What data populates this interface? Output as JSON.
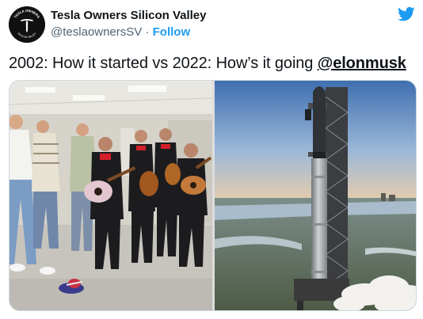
{
  "header": {
    "display_name": "Tesla Owners Silicon Valley",
    "handle": "@teslaownersSV",
    "separator": "·",
    "follow_label": "Follow",
    "avatar_text_top": "TESLA OWNERS",
    "avatar_text_bottom": "SILICON VALLEY",
    "avatar_icon": "tesla-t-logo",
    "brand_icon": "twitter-bird-icon"
  },
  "tweet": {
    "text": "2002: How it started vs 2022: How’s it going ",
    "mention": "@elonmusk"
  },
  "media": {
    "left_photo": "mariachi-group-photo",
    "right_photo": "starship-launch-tower-photo"
  },
  "colors": {
    "accent": "#1d9bf0",
    "text": "#0f1419",
    "secondary": "#536471"
  }
}
